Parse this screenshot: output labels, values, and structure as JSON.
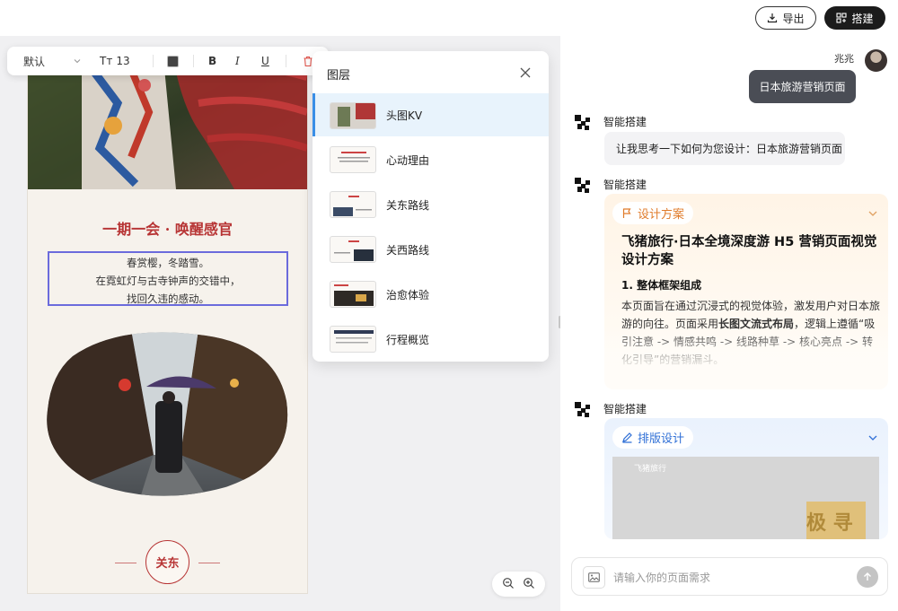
{
  "header": {
    "export_label": "导出",
    "build_label": "搭建"
  },
  "toolbar": {
    "font_name": "默认",
    "font_size": "13",
    "bold": "B",
    "italic": "I",
    "underline": "U"
  },
  "page": {
    "headline": "一期一会 · 唤醒感官",
    "poem_lines": [
      "春赏樱，冬踏雪。",
      "在霓虹灯与古寺钟声的交错中，",
      "找回久违的感动。"
    ],
    "section_seal": "关东"
  },
  "layers": {
    "title": "图层",
    "items": [
      {
        "label": "头图KV",
        "selected": true
      },
      {
        "label": "心动理由",
        "selected": false
      },
      {
        "label": "关东路线",
        "selected": false
      },
      {
        "label": "关西路线",
        "selected": false
      },
      {
        "label": "治愈体验",
        "selected": false
      },
      {
        "label": "行程概览",
        "selected": false
      }
    ]
  },
  "chat": {
    "user_name": "兆兆",
    "user_message": "日本旅游营销页面",
    "bot_name": "智能搭建",
    "bot_message_1": "让我思考一下如何为您设计：日本旅游营销页面",
    "design_card": {
      "tag": "设计方案",
      "title": "飞猪旅行·日本全境深度游 H5 营销页面视觉设计方案",
      "section": "1. 整体框架组成",
      "body_1": "本页面旨在通过沉浸式的视觉体验，激发用户对日本旅游的向往。页面采用",
      "body_bold": "长图文流式布局",
      "body_2": "，逻辑上遵循“吸引注意 -> 情感共鸣 -> 线路种草 -> 核心亮点 -> 转化引导”的营销漏斗。"
    },
    "layout_card": {
      "tag": "排版设计",
      "preview_brand": "飞猪旅行",
      "preview_big": "极 寻"
    },
    "input_placeholder": "请输入你的页面需求"
  },
  "colors": {
    "accent_red": "#b73434",
    "selection_blue": "#6b6bdc",
    "layer_selected": "#e8f3fc",
    "dark_button": "#1b1b1b"
  }
}
